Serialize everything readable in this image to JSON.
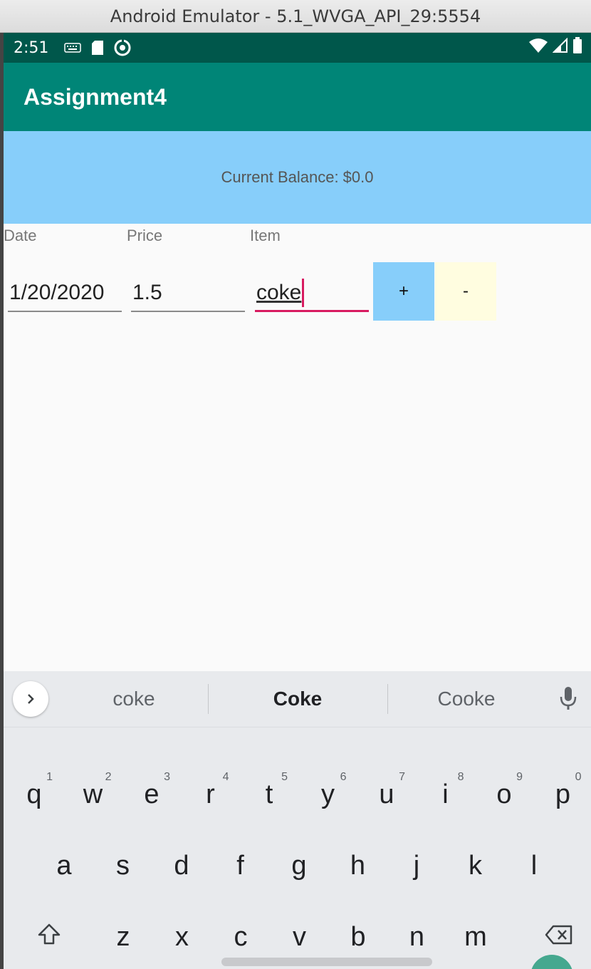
{
  "window": {
    "title": "Android Emulator - 5.1_WVGA_API_29:5554"
  },
  "status_bar": {
    "time": "2:51",
    "icons": [
      "keyboard-icon",
      "sd-card-icon",
      "sync-icon",
      "wifi-icon",
      "signal-icon",
      "battery-icon"
    ]
  },
  "app_bar": {
    "title": "Assignment4",
    "color": "#008577"
  },
  "balance": {
    "text": "Current Balance: $0.0",
    "background": "#87cefa"
  },
  "form": {
    "labels": {
      "date": "Date",
      "price": "Price",
      "item": "Item"
    },
    "values": {
      "date": "1/20/2020",
      "price": "1.5",
      "item": "coke"
    },
    "buttons": {
      "add": "+",
      "subtract": "-"
    }
  },
  "keyboard": {
    "suggestions": [
      "coke",
      "Coke",
      "Cooke"
    ],
    "rows": [
      [
        {
          "key": "q",
          "hint": "1"
        },
        {
          "key": "w",
          "hint": "2"
        },
        {
          "key": "e",
          "hint": "3"
        },
        {
          "key": "r",
          "hint": "4"
        },
        {
          "key": "t",
          "hint": "5"
        },
        {
          "key": "y",
          "hint": "6"
        },
        {
          "key": "u",
          "hint": "7"
        },
        {
          "key": "i",
          "hint": "8"
        },
        {
          "key": "o",
          "hint": "9"
        },
        {
          "key": "p",
          "hint": "0"
        }
      ],
      [
        {
          "key": "a"
        },
        {
          "key": "s"
        },
        {
          "key": "d"
        },
        {
          "key": "f"
        },
        {
          "key": "g"
        },
        {
          "key": "h"
        },
        {
          "key": "j"
        },
        {
          "key": "k"
        },
        {
          "key": "l"
        }
      ],
      [
        {
          "key": "z"
        },
        {
          "key": "x"
        },
        {
          "key": "c"
        },
        {
          "key": "v"
        },
        {
          "key": "b"
        },
        {
          "key": "n"
        },
        {
          "key": "m"
        }
      ]
    ],
    "special_keys": {
      "shift": "shift-icon",
      "backspace": "backspace-icon",
      "expand": "chevron-right-icon",
      "mic": "mic-icon"
    }
  }
}
